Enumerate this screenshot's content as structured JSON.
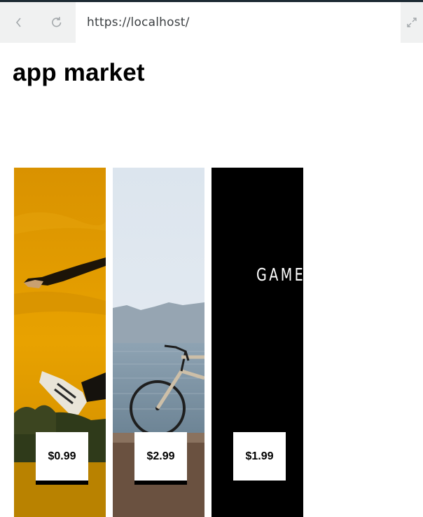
{
  "browser": {
    "url": "https://localhost/",
    "back_icon": "chevron-left-icon",
    "reload_icon": "reload-icon",
    "expand_icon": "expand-icon"
  },
  "page": {
    "title": "app market"
  },
  "apps": [
    {
      "price": "$0.99",
      "image": "person-jumping-yellow-sky"
    },
    {
      "price": "$2.99",
      "image": "bicycle-by-sea"
    },
    {
      "price": "$1.99",
      "image": "game-black-banner",
      "banner_text": "GAME"
    }
  ],
  "colors": {
    "browser_bar": "#f0f1f1",
    "card_1_bg": "#e09a00",
    "card_3_bg": "#000000"
  }
}
